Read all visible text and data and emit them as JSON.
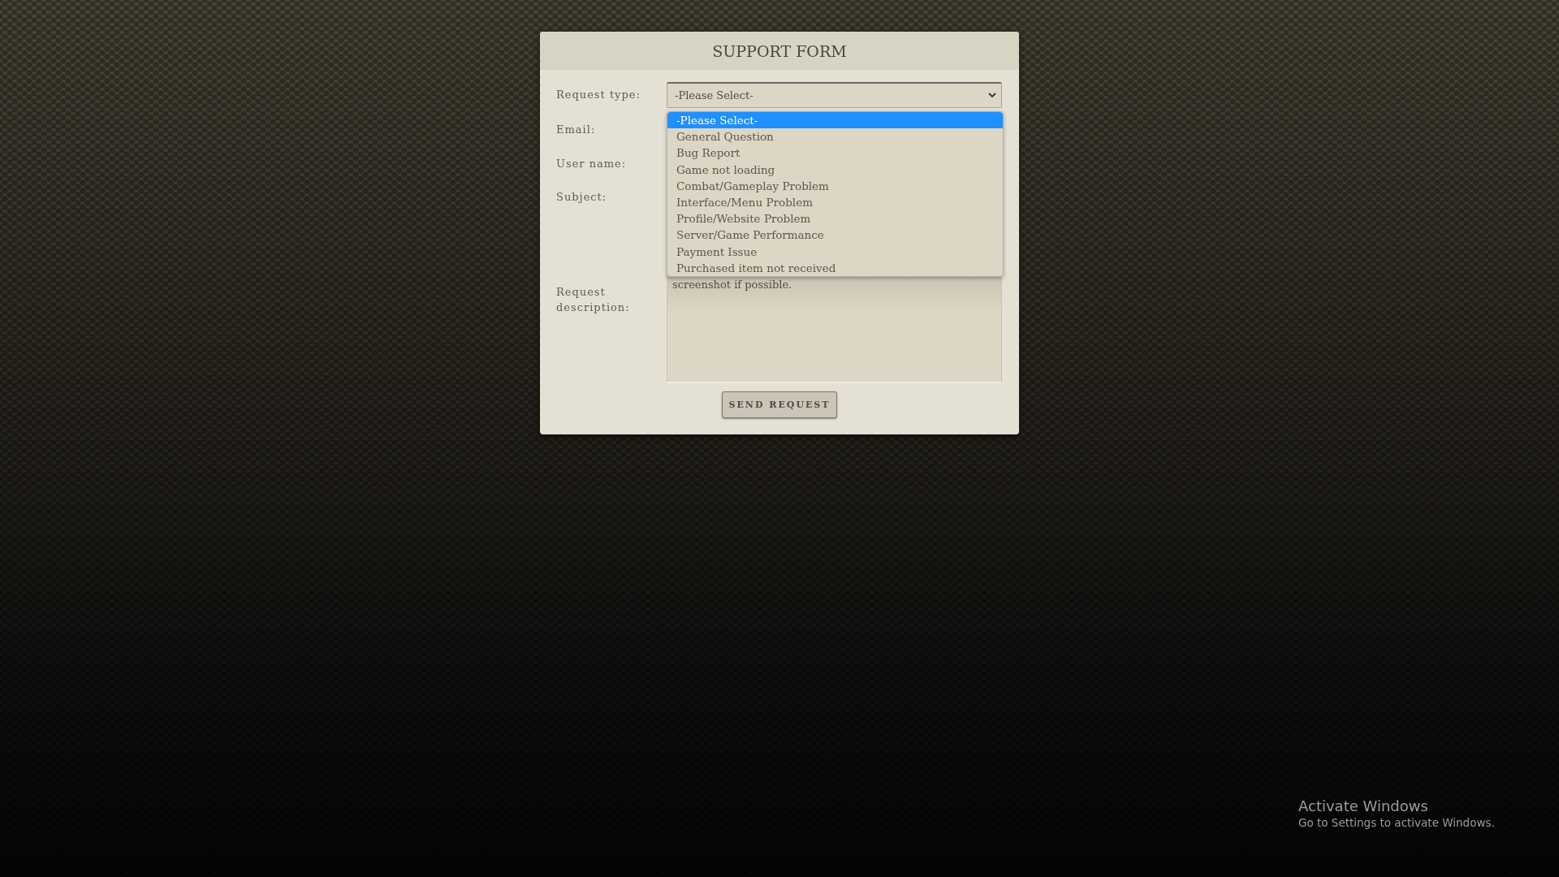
{
  "form": {
    "title": "SUPPORT FORM",
    "fields": [
      {
        "label": "Request type:",
        "kind": "select",
        "value": "-Please Select-"
      },
      {
        "label": "Email:",
        "kind": "input"
      },
      {
        "label": "User name:",
        "kind": "input"
      },
      {
        "label": "Subject:",
        "kind": "input"
      },
      {
        "label": "Request description:",
        "kind": "textarea",
        "placeholder": "screenshot if possible."
      }
    ],
    "dropdown": {
      "options": [
        {
          "label": "-Please Select-",
          "selected": true
        },
        {
          "label": "General Question",
          "selected": false
        },
        {
          "label": "Bug Report",
          "selected": false
        },
        {
          "label": "Game not loading",
          "selected": false
        },
        {
          "label": "Combat/Gameplay Problem",
          "selected": false
        },
        {
          "label": "Interface/Menu Problem",
          "selected": false
        },
        {
          "label": "Profile/Website Problem",
          "selected": false
        },
        {
          "label": "Server/Game Performance",
          "selected": false
        },
        {
          "label": "Payment Issue",
          "selected": false
        },
        {
          "label": "Purchased item not received",
          "selected": false
        }
      ]
    },
    "submit": "SEND REQUEST"
  },
  "activation_notice": {
    "title": "Activate Windows",
    "message": "Go to Settings to activate Windows."
  }
}
